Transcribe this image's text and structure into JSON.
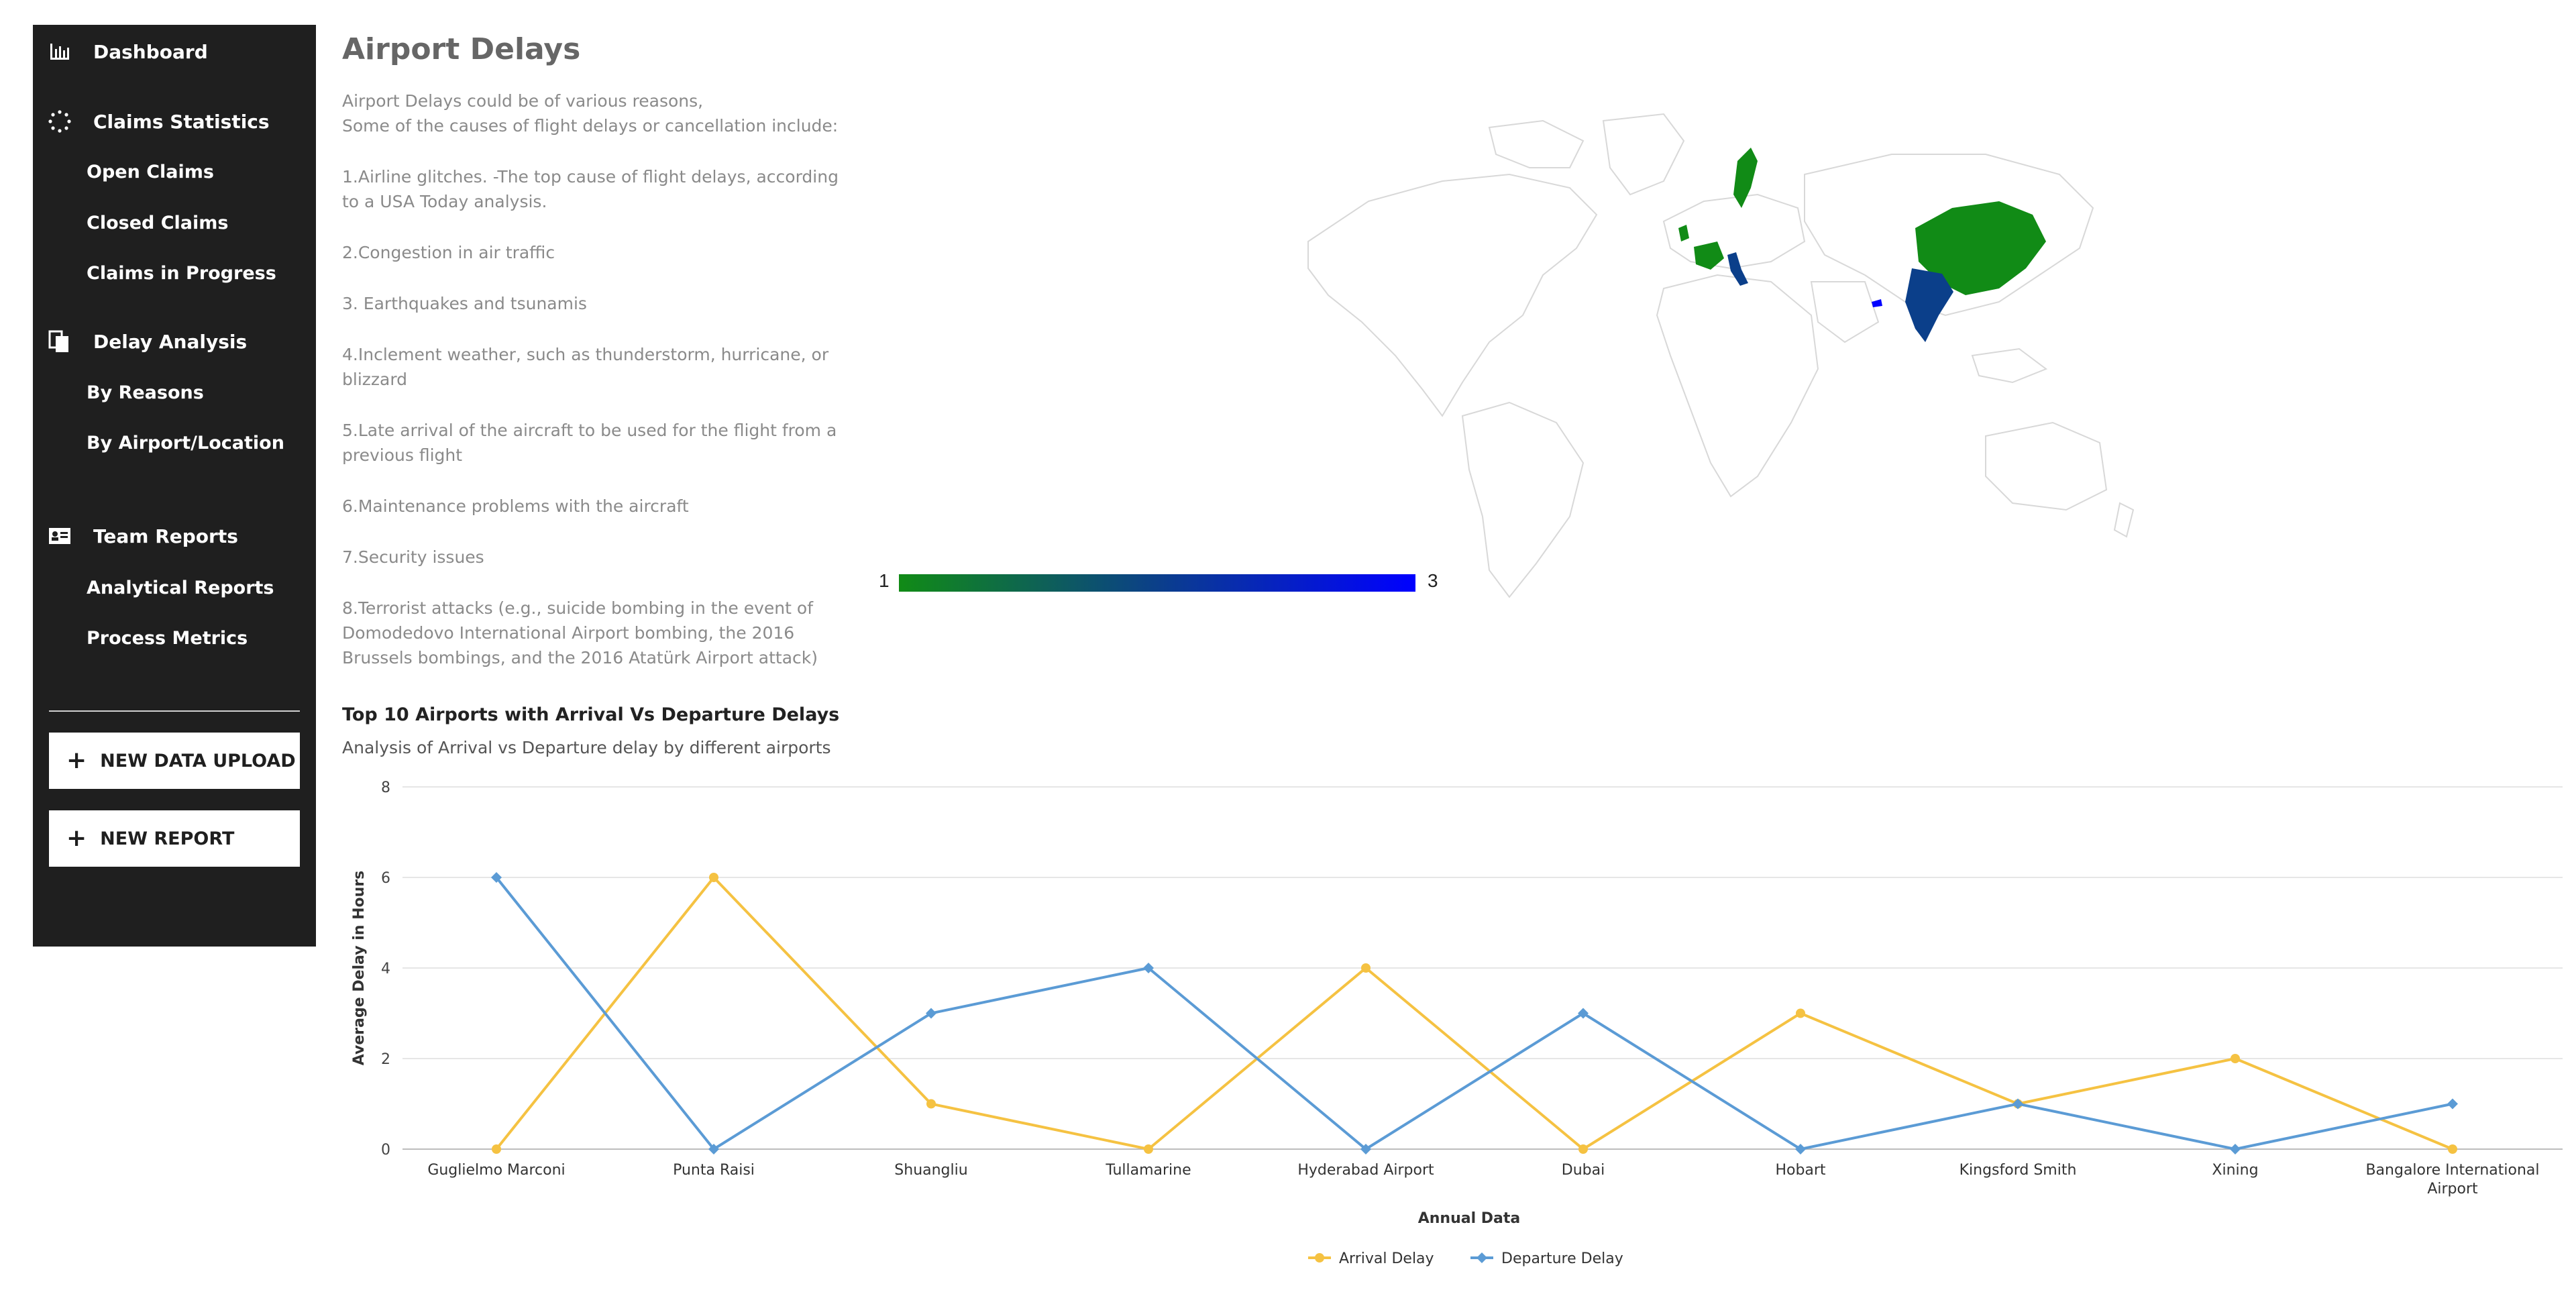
{
  "sidebar": {
    "dashboard": "Dashboard",
    "claims_statistics": "Claims Statistics",
    "open_claims": "Open Claims",
    "closed_claims": "Closed Claims",
    "claims_in_progress": "Claims in Progress",
    "delay_analysis": "Delay Analysis",
    "by_reasons": "By Reasons",
    "by_airport": "By Airport/Location",
    "team_reports": "Team Reports",
    "analytical_reports": "Analytical Reports",
    "process_metrics": "Process Metrics",
    "new_data_upload": "NEW DATA UPLOAD",
    "new_report": "NEW REPORT"
  },
  "main": {
    "title": "Airport Delays",
    "intro_line1": "Airport Delays could be of various reasons,",
    "intro_line2": "Some of the causes of flight delays or cancellation include:",
    "causes": [
      "1.Airline glitches. -The top cause of flight delays, according to a USA Today analysis.",
      "2.Congestion in air traffic",
      "3. Earthquakes and tsunamis",
      "4.Inclement weather, such as thunderstorm, hurricane, or blizzard",
      "5.Late arrival of the aircraft to be used for the flight from a previous flight",
      "6.Maintenance problems with the aircraft",
      "7.Security issues",
      "8.Terrorist attacks (e.g., suicide bombing in the event of Domodedovo International Airport bombing, the 2016 Brussels bombings, and the 2016 Atatürk Airport attack)"
    ]
  },
  "map": {
    "legend_min": "1",
    "legend_max": "3",
    "colors": {
      "low": "#118b16",
      "mid": "#0b3f8a",
      "high": "#0000ff",
      "land": "#ffffff",
      "border": "#d8d8d8"
    }
  },
  "chart_data": {
    "type": "line",
    "title": "Top 10 Airports with Arrival Vs Departure Delays",
    "subtitle": "Analysis of Arrival vs Departure delay by different airports",
    "xlabel": "Annual Data",
    "ylabel": "Average Delay in Hours",
    "ylim": [
      0,
      8
    ],
    "yticks": [
      0,
      2,
      4,
      6,
      8
    ],
    "categories": [
      "Guglielmo Marconi",
      "Punta Raisi",
      "Shuangliu",
      "Tullamarine",
      "Hyderabad Airport",
      "Dubai",
      "Hobart",
      "Kingsford Smith",
      "Xining",
      "Bangalore International Airport"
    ],
    "series": [
      {
        "name": "Arrival Delay",
        "color": "#f5c242",
        "values": [
          0,
          6,
          1,
          0,
          4,
          0,
          3,
          1,
          2,
          0
        ]
      },
      {
        "name": "Departure Delay",
        "color": "#5b9bd5",
        "values": [
          6,
          0,
          3,
          4,
          0,
          3,
          0,
          1,
          0,
          1
        ]
      }
    ],
    "grid": true,
    "legend": "bottom"
  }
}
